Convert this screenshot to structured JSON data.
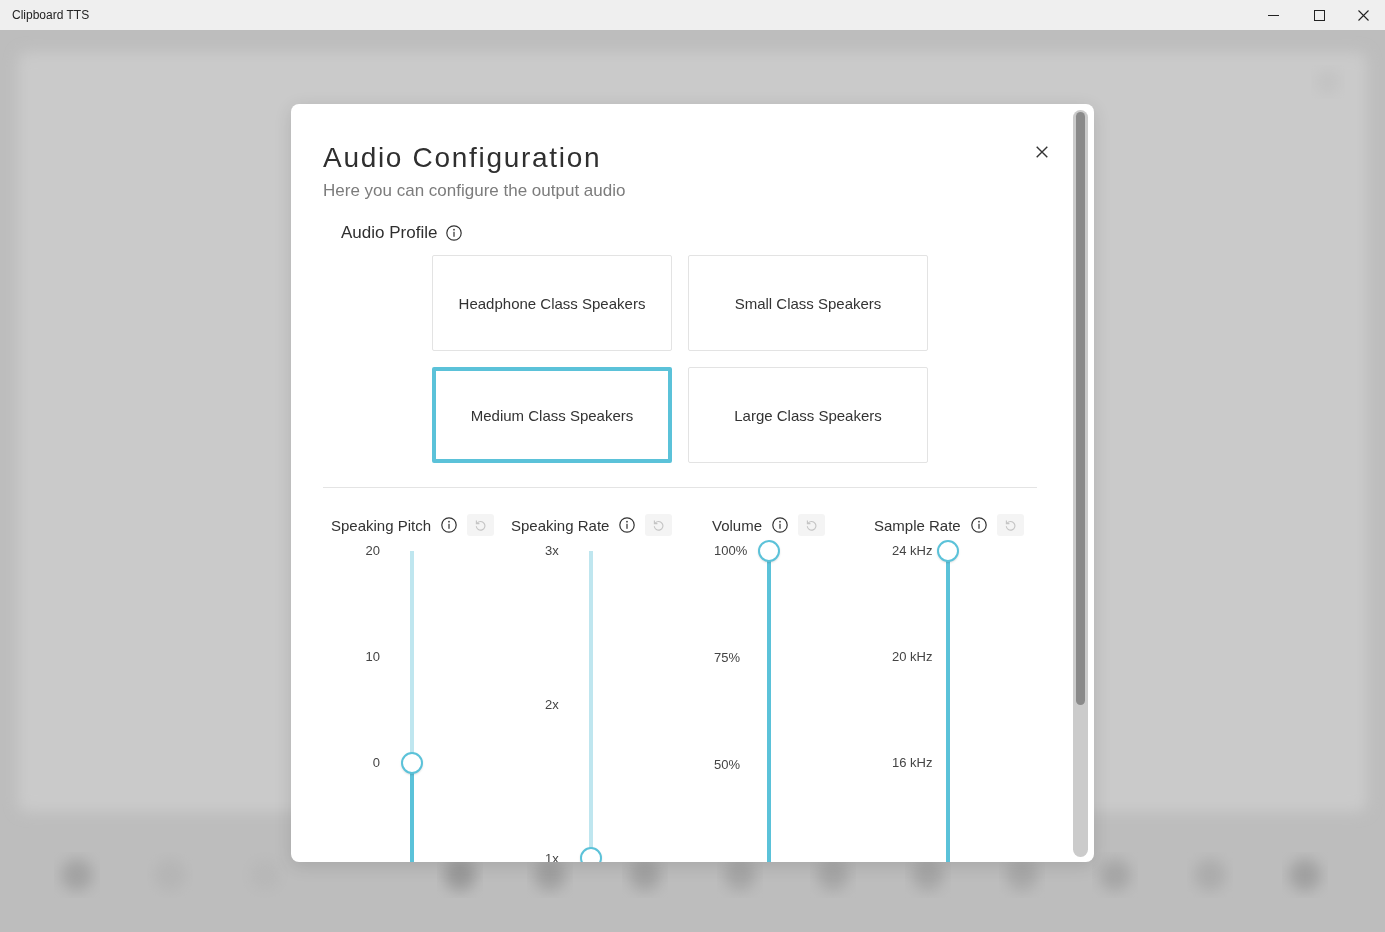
{
  "window": {
    "title": "Clipboard TTS"
  },
  "dialog": {
    "title": "Audio Configuration",
    "subtitle": "Here you can configure the output audio",
    "audio_profile": {
      "label": "Audio Profile",
      "options": [
        {
          "label": "Headphone Class Speakers",
          "selected": false
        },
        {
          "label": "Small Class Speakers",
          "selected": false
        },
        {
          "label": "Medium Class Speakers",
          "selected": true
        },
        {
          "label": "Large Class Speakers",
          "selected": false
        }
      ]
    },
    "sliders": [
      {
        "label": "Speaking Pitch",
        "ticks": [
          "20",
          "10",
          "0"
        ],
        "level": 0.5,
        "reset": {
          "disabled": true
        }
      },
      {
        "label": "Speaking Rate",
        "ticks": [
          "3x",
          "2x",
          "1x"
        ],
        "level": 0.275,
        "reset": {
          "disabled": true
        }
      },
      {
        "label": "Volume",
        "ticks": [
          "100%",
          "75%",
          "50%"
        ],
        "level": 1,
        "reset": {
          "disabled": true
        }
      },
      {
        "label": "Sample Rate",
        "ticks": [
          "24 kHz",
          "20 kHz",
          "16 kHz"
        ],
        "level": 1,
        "reset": {
          "disabled": true
        }
      }
    ]
  }
}
